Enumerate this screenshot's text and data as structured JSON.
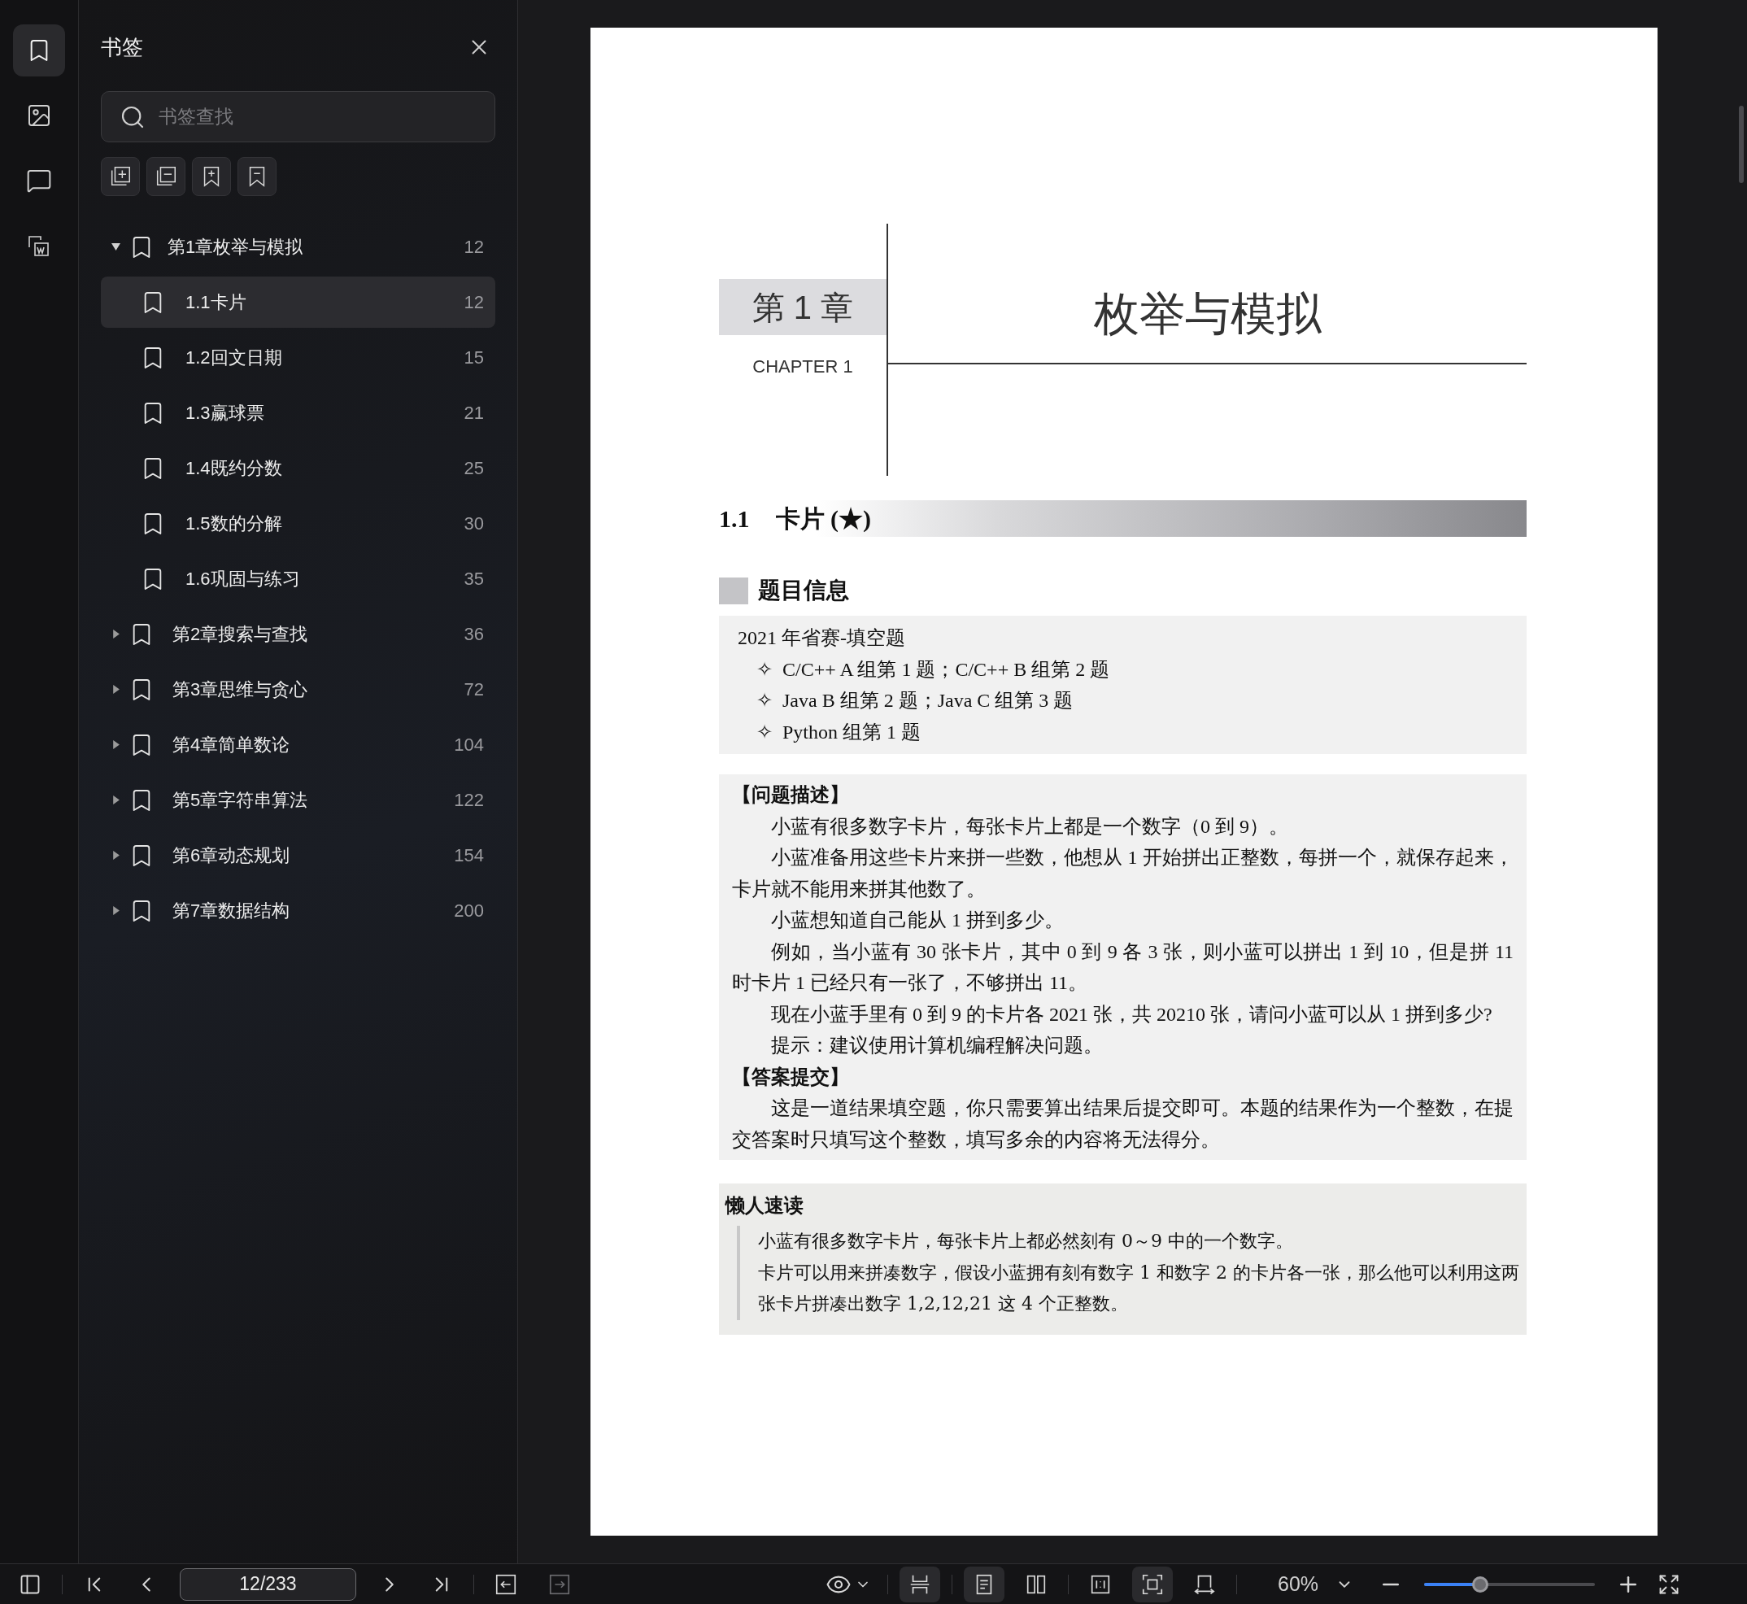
{
  "rail": [
    {
      "kind": "bookmarks",
      "selected": true
    },
    {
      "kind": "images",
      "selected": false
    },
    {
      "kind": "comments",
      "selected": false
    },
    {
      "kind": "convert",
      "selected": false
    }
  ],
  "bookmark_panel": {
    "title": "书签",
    "search": {
      "placeholder": "书签查找"
    },
    "actions": [
      {
        "kind": "expand-all"
      },
      {
        "kind": "collapse-all"
      },
      {
        "kind": "add"
      },
      {
        "kind": "remove"
      }
    ],
    "tree": [
      {
        "label": "第1章枚举与模拟",
        "page": "12",
        "expanded": true,
        "selected": false,
        "children": [
          {
            "label": "1.1卡片",
            "page": "12",
            "selected": true
          },
          {
            "label": "1.2回文日期",
            "page": "15",
            "selected": false
          },
          {
            "label": "1.3赢球票",
            "page": "21",
            "selected": false
          },
          {
            "label": "1.4既约分数",
            "page": "25",
            "selected": false
          },
          {
            "label": "1.5数的分解",
            "page": "30",
            "selected": false
          },
          {
            "label": "1.6巩固与练习",
            "page": "35",
            "selected": false
          }
        ]
      },
      {
        "label": "第2章搜索与查找",
        "page": "36",
        "expanded": false,
        "selected": false
      },
      {
        "label": "第3章思维与贪心",
        "page": "72",
        "expanded": false,
        "selected": false
      },
      {
        "label": "第4章简单数论",
        "page": "104",
        "expanded": false,
        "selected": false
      },
      {
        "label": "第5章字符串算法",
        "page": "122",
        "expanded": false,
        "selected": false
      },
      {
        "label": "第6章动态规划",
        "page": "154",
        "expanded": false,
        "selected": false
      },
      {
        "label": "第7章数据结构",
        "page": "200",
        "expanded": false,
        "selected": false
      }
    ]
  },
  "page": {
    "chapter_label": "第 1 章",
    "chapter_en": "CHAPTER 1",
    "chapter_title": "枚举与模拟",
    "section_number": "1.1",
    "section_title": "卡片 (★)",
    "info_heading": "题目信息",
    "info_title": "2021 年省赛-填空题",
    "bullet": "✧",
    "info_items": [
      "C/C++ A 组第 1 题；C/C++ B 组第 2 题",
      "Java B 组第 2 题；Java C 组第 3 题",
      "Python 组第 1 题"
    ],
    "problem_heading": "【问题描述】",
    "problem_paragraphs": [
      "小蓝有很多数字卡片，每张卡片上都是一个数字（0 到 9）。",
      "小蓝准备用这些卡片来拼一些数，他想从 1 开始拼出正整数，每拼一个，就保存起来，卡片就不能用来拼其他数了。",
      "小蓝想知道自己能从 1 拼到多少。",
      "例如，当小蓝有 30 张卡片，其中 0 到 9 各 3 张，则小蓝可以拼出 1 到 10，但是拼 11 时卡片 1 已经只有一张了，不够拼出 11。",
      "现在小蓝手里有 0 到 9 的卡片各 2021 张，共 20210 张，请问小蓝可以从 1 拼到多少?",
      "提示：建议使用计算机编程解决问题。"
    ],
    "answer_heading": "【答案提交】",
    "answer_paragraphs": [
      "这是一道结果填空题，你只需要算出结果后提交即可。本题的结果作为一个整数，在提交答案时只填写这个整数，填写多余的内容将无法得分。"
    ],
    "lazy_heading": "懒人速读",
    "lazy_lines": [
      "小蓝有很多数字卡片，每张卡片上都必然刻有 0～9 中的一个数字。",
      "卡片可以用来拼凑数字，假设小蓝拥有刻有数字 1 和数字 2 的卡片各一张，那么他可以利用这两张卡片拼凑出数字 1,2,12,21 这 4 个正整数。"
    ]
  },
  "toolbar": {
    "page_value": "12/233",
    "back_disabled": false,
    "forward_disabled": true,
    "view_groups": [
      [
        {
          "kind": "continuous",
          "selected": true
        }
      ],
      [
        {
          "kind": "single",
          "selected": true
        },
        {
          "kind": "double",
          "selected": false
        }
      ],
      [
        {
          "kind": "actual",
          "selected": false
        },
        {
          "kind": "fit",
          "selected": true
        },
        {
          "kind": "rotate",
          "selected": false
        }
      ]
    ],
    "zoom": "60%",
    "zoom_slider": {
      "level": 0.33
    }
  }
}
